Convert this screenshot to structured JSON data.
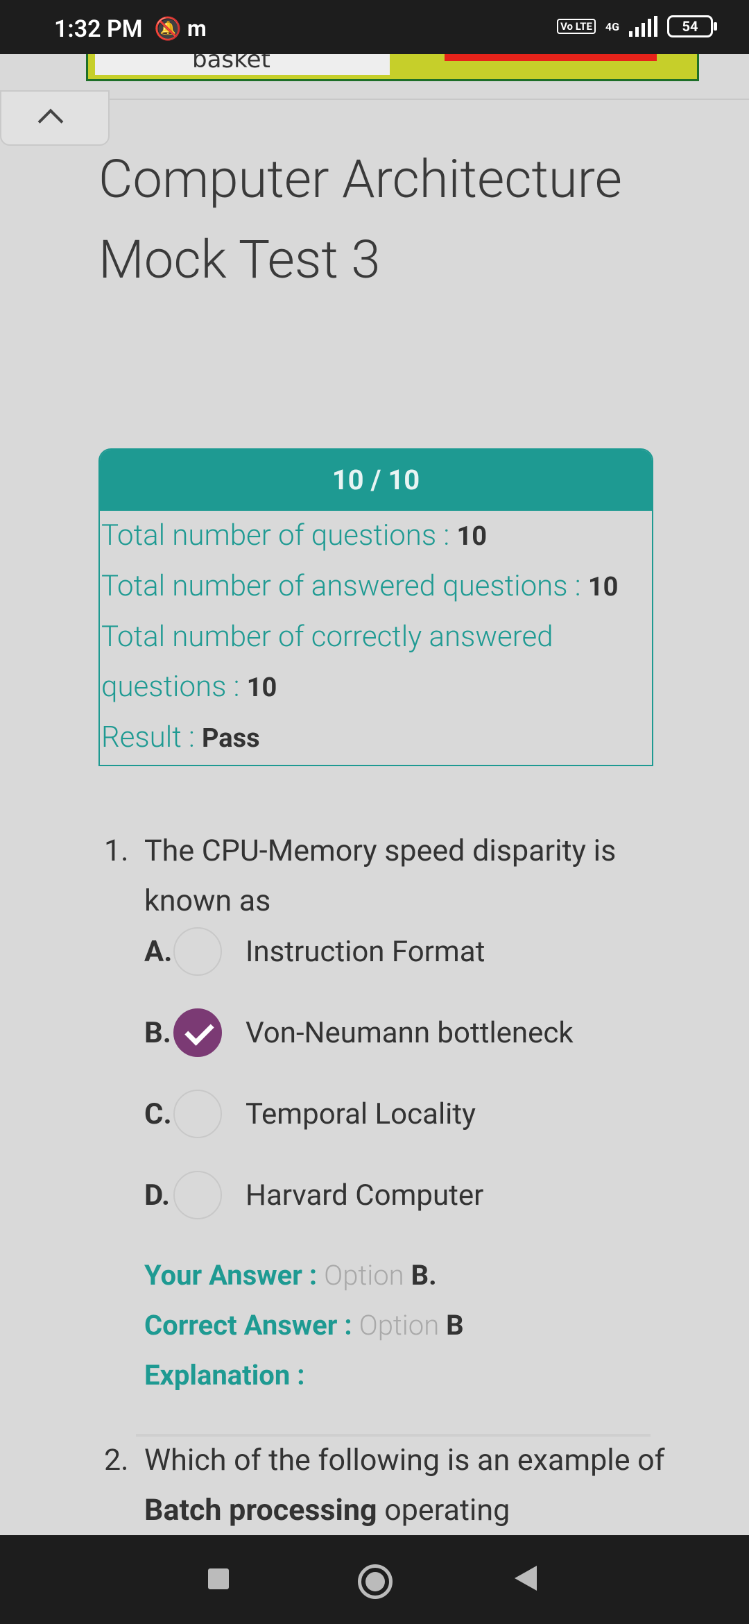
{
  "status_bar": {
    "time": "1:32 PM",
    "battery": "54",
    "network": "4G",
    "volte": "Vo LTE"
  },
  "ad": {
    "logo_text": "basket"
  },
  "page": {
    "title": "Computer Architecture Mock Test 3"
  },
  "result": {
    "score": "10 / 10",
    "rows": [
      {
        "label": "Total number of questions :",
        "value": "10"
      },
      {
        "label": "Total number of answered questions :",
        "value": "10"
      },
      {
        "label": "Total number of correctly answered questions :",
        "value": "10"
      },
      {
        "label": "Result :",
        "value": "Pass"
      }
    ]
  },
  "questions": [
    {
      "number": "1.",
      "text": "The CPU-Memory speed disparity is known as",
      "options": [
        {
          "letter": "A.",
          "text": "Instruction Format",
          "selected": false
        },
        {
          "letter": "B.",
          "text": "Von-Neumann bottleneck",
          "selected": true
        },
        {
          "letter": "C.",
          "text": "Temporal Locality",
          "selected": false
        },
        {
          "letter": "D.",
          "text": "Harvard Computer",
          "selected": false
        }
      ],
      "your_answer_label": "Your Answer :",
      "your_answer_prefix": "Option",
      "your_answer_value": "B.",
      "correct_answer_label": "Correct Answer :",
      "correct_answer_prefix": "Option",
      "correct_answer_value": "B",
      "explanation_label": "Explanation :"
    },
    {
      "number": "2.",
      "text_pre": "Which of the following is an example of",
      "text_bold": "Batch processing",
      "text_post": "operating"
    }
  ]
}
